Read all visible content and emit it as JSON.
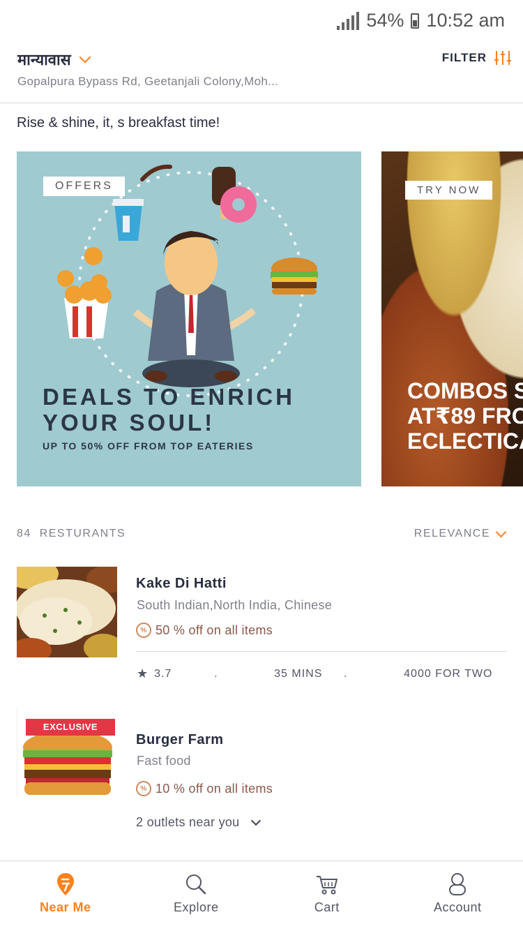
{
  "status_bar": {
    "battery": "54%",
    "time": "10:52 am"
  },
  "header": {
    "location_title": "मान्यावास",
    "location_subtitle": "Gopalpura Bypass Rd, Geetanjali Colony,Moh...",
    "filter_label": "FILTER"
  },
  "greeting": "Rise & shine, it, s breakfast time!",
  "carousel": [
    {
      "tag": "OFFERS",
      "title_line1": "DEALS TO ENRICH",
      "title_line2": "YOUR SOUL!",
      "subtitle": "UP TO 50% OFF FROM TOP EATERIES"
    },
    {
      "tag": "TRY NOW",
      "title_line1": "COMBOS S",
      "title_line2": "AT₹89 FRO",
      "title_line3": "ECLECTICA"
    }
  ],
  "list": {
    "count": "84",
    "count_label": "RESTURANTS",
    "sort_label": "RELEVANCE"
  },
  "restaurants": [
    {
      "name": "Kake Di Hatti",
      "cuisine": "South Indian,North India, Chinese",
      "offer_icon": "%",
      "offer": "50 % off on all items",
      "rating": "3.7",
      "sep": ".",
      "time": "35 MINS",
      "cost": "4000 FOR TWO"
    },
    {
      "badge": "EXCLUSIVE",
      "name": "Burger Farm",
      "cuisine": "Fast food",
      "offer_icon": "%",
      "offer": "10 % off on all items",
      "outlets": "2 outlets near you"
    }
  ],
  "bottom_nav": [
    {
      "label": "Near Me",
      "icon": "swiggy-logo-icon",
      "active": true
    },
    {
      "label": "Explore",
      "icon": "search-icon",
      "active": false
    },
    {
      "label": "Cart",
      "icon": "cart-icon",
      "active": false
    },
    {
      "label": "Account",
      "icon": "account-icon",
      "active": false
    }
  ],
  "colors": {
    "accent": "#fc8019",
    "text_dark": "#282c3f",
    "text_muted": "#7e808c",
    "offer": "#8a584b"
  }
}
